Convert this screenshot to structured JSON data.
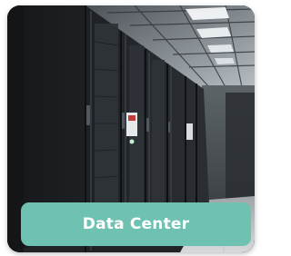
{
  "card": {
    "label": "Data Center",
    "image_icon": "server-room-photo"
  },
  "colors": {
    "label_background": "#6fc2b2",
    "label_text": "#ffffff",
    "rack_dark": "#1b1d20",
    "ceiling_light": "#e9eef2",
    "floor_light": "#cfd3d6"
  }
}
